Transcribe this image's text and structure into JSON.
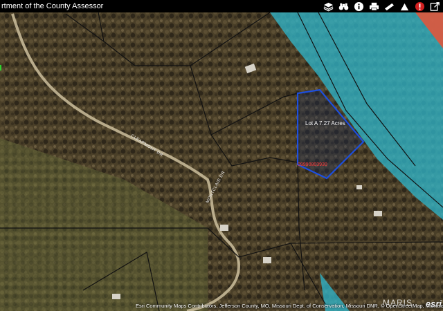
{
  "header": {
    "title": "rtment of the County Assessor"
  },
  "toolbar": {
    "icons": [
      "layers-icon",
      "binoculars-icon",
      "info-icon",
      "print-icon",
      "measure-icon",
      "upload-icon",
      "alert-icon",
      "share-icon"
    ]
  },
  "map": {
    "lot_label": "Lot A  7.27 Acres",
    "parcel_id": "09990803930",
    "road_1": "CLEARMONT DR",
    "road_2": "MONTCLAIR DR",
    "attribution": "Esri Community Maps Contributors, Jefferson County, MO, Missouri Dept. of Conservation, Missouri DNR, © OpenStreetMap, Microsoft",
    "esri_logo": "esri",
    "watermark": "MARIS",
    "colors": {
      "flood_zone": "#2fb3c8",
      "flood_zone_b": "#e0573c",
      "parcel_outline": "#1d4fe0",
      "parcel_lines": "#111111"
    }
  }
}
